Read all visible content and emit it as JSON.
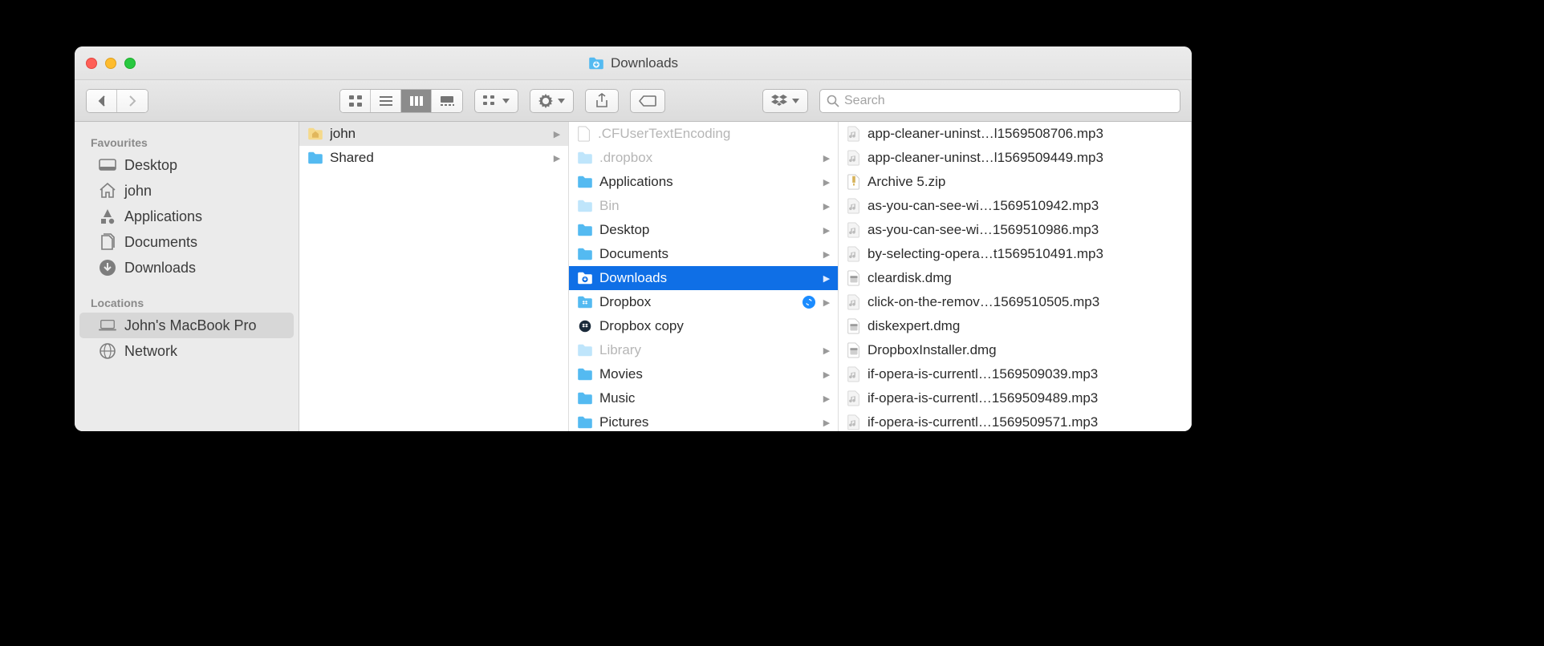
{
  "window": {
    "title": "Downloads"
  },
  "search": {
    "placeholder": "Search"
  },
  "sidebar": {
    "groups": [
      {
        "label": "Favourites",
        "items": [
          {
            "label": "Desktop",
            "icon": "desktop"
          },
          {
            "label": "john",
            "icon": "home"
          },
          {
            "label": "Applications",
            "icon": "apps"
          },
          {
            "label": "Documents",
            "icon": "docs"
          },
          {
            "label": "Downloads",
            "icon": "downloads"
          }
        ]
      },
      {
        "label": "Locations",
        "items": [
          {
            "label": "John's MacBook Pro",
            "icon": "laptop",
            "selected": true
          },
          {
            "label": "Network",
            "icon": "network"
          }
        ]
      }
    ]
  },
  "columns": [
    [
      {
        "label": "john",
        "icon": "home-folder",
        "hasChildren": true,
        "selected": "path"
      },
      {
        "label": "Shared",
        "icon": "folder",
        "hasChildren": true
      }
    ],
    [
      {
        "label": ".CFUserTextEncoding",
        "icon": "file",
        "dim": true
      },
      {
        "label": ".dropbox",
        "icon": "folder-dim",
        "dim": true,
        "hasChildren": true
      },
      {
        "label": "Applications",
        "icon": "folder",
        "hasChildren": true
      },
      {
        "label": "Bin",
        "icon": "folder-dim",
        "dim": true,
        "hasChildren": true
      },
      {
        "label": "Desktop",
        "icon": "folder",
        "hasChildren": true
      },
      {
        "label": "Documents",
        "icon": "folder",
        "hasChildren": true
      },
      {
        "label": "Downloads",
        "icon": "folder-dl",
        "hasChildren": true,
        "selected": "sel"
      },
      {
        "label": "Dropbox",
        "icon": "folder-dropbox",
        "hasChildren": true,
        "sync": true
      },
      {
        "label": "Dropbox copy",
        "icon": "dropbox-app"
      },
      {
        "label": "Library",
        "icon": "folder-dim",
        "dim": true,
        "hasChildren": true
      },
      {
        "label": "Movies",
        "icon": "folder",
        "hasChildren": true
      },
      {
        "label": "Music",
        "icon": "folder",
        "hasChildren": true
      },
      {
        "label": "Pictures",
        "icon": "folder",
        "hasChildren": true
      }
    ],
    [
      {
        "label": "app-cleaner-uninst…l1569508706.mp3",
        "icon": "audio"
      },
      {
        "label": "app-cleaner-uninst…l1569509449.mp3",
        "icon": "audio"
      },
      {
        "label": "Archive 5.zip",
        "icon": "zip"
      },
      {
        "label": "as-you-can-see-wi…1569510942.mp3",
        "icon": "audio"
      },
      {
        "label": "as-you-can-see-wi…1569510986.mp3",
        "icon": "audio"
      },
      {
        "label": "by-selecting-opera…t1569510491.mp3",
        "icon": "audio"
      },
      {
        "label": "cleardisk.dmg",
        "icon": "dmg"
      },
      {
        "label": "click-on-the-remov…1569510505.mp3",
        "icon": "audio"
      },
      {
        "label": "diskexpert.dmg",
        "icon": "dmg"
      },
      {
        "label": "DropboxInstaller.dmg",
        "icon": "dmg"
      },
      {
        "label": "if-opera-is-currentl…1569509039.mp3",
        "icon": "audio"
      },
      {
        "label": "if-opera-is-currentl…1569509489.mp3",
        "icon": "audio"
      },
      {
        "label": "if-opera-is-currentl…1569509571.mp3",
        "icon": "audio"
      }
    ]
  ]
}
